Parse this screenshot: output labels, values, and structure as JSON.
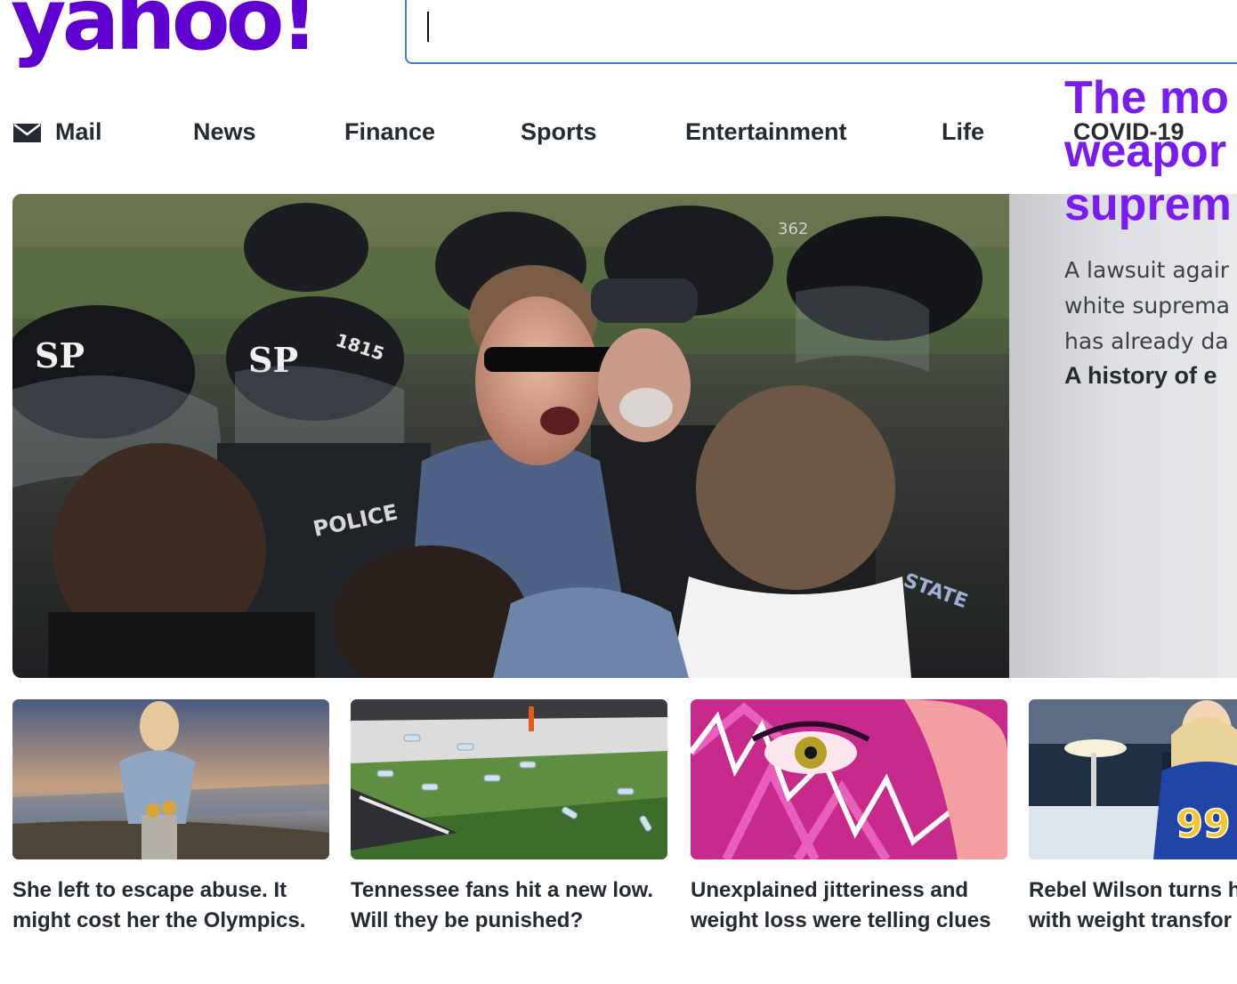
{
  "header": {
    "logo_text": "yahoo!",
    "search": {
      "value": "",
      "placeholder": ""
    }
  },
  "nav": {
    "items": [
      {
        "label": "Mail",
        "icon": "mail-icon"
      },
      {
        "label": "News"
      },
      {
        "label": "Finance"
      },
      {
        "label": "Sports"
      },
      {
        "label": "Entertainment"
      },
      {
        "label": "Life"
      },
      {
        "label": "COVID-19"
      }
    ]
  },
  "hero": {
    "image_texts": [
      "SP",
      "SP",
      "1815",
      "POLICE",
      "STATE",
      "362"
    ],
    "title": "The mo\nweapor\nsuprem",
    "summary": "A lawsuit agair\nwhite suprema\nhas already da",
    "link": "A history of e"
  },
  "cards": [
    {
      "title": "She left to escape abuse. It\nmight cost her the Olympics."
    },
    {
      "title": "Tennessee fans hit a new low.\nWill they be punished?"
    },
    {
      "title": "Unexplained jitteriness and\nweight loss were telling clues"
    },
    {
      "title": "Rebel Wilson turns h\nwith weight transfor",
      "image_text": "99"
    }
  ],
  "colors": {
    "brand": "#6001d2",
    "hero_title": "#7a1bf2",
    "search_border": "#3b7be0",
    "text": "#232a31"
  }
}
